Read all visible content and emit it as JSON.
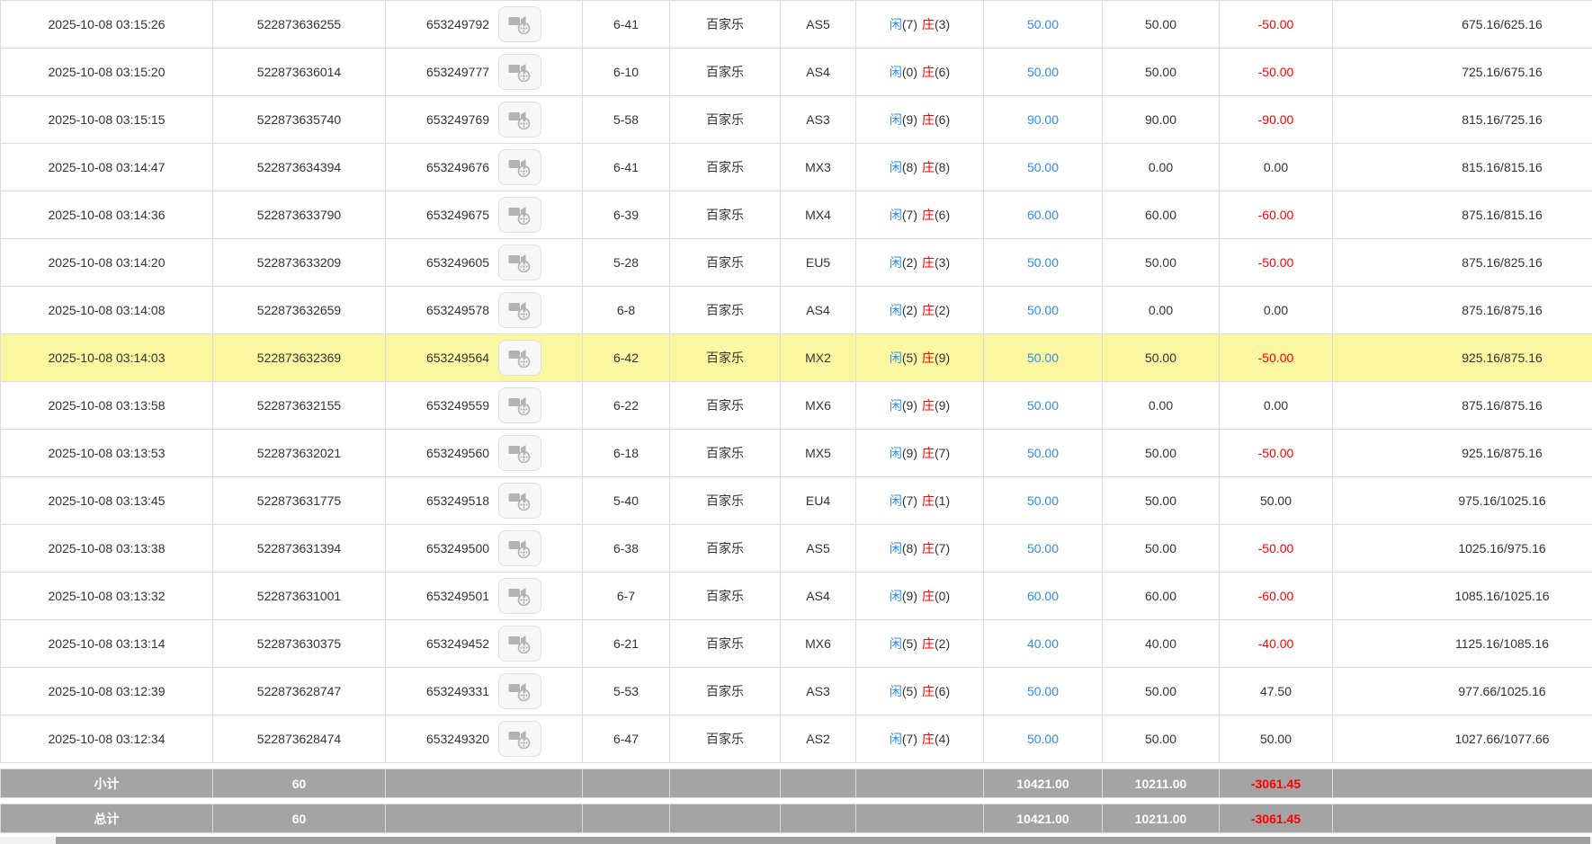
{
  "colors": {
    "accent_blue": "#2d8cf0",
    "accent_red": "#ff0000",
    "highlight_row": "#fbf7a1",
    "summary_bg": "#a4a4a4"
  },
  "result_labels": {
    "player": "闲",
    "banker": "庄"
  },
  "icons": {
    "round_video_icon": "video-replay-icon"
  },
  "rows": [
    {
      "time": "2025-10-08 03:15:26",
      "order_id": "522873636255",
      "round_id": "653249792",
      "shoe_round": "6-41",
      "game": "百家乐",
      "table": "AS5",
      "player_score": "(7)",
      "banker_score": "(3)",
      "bet": "50.00",
      "valid_bet": "50.00",
      "win_loss": "-50.00",
      "balance": "675.16/625.16",
      "highlighted": false
    },
    {
      "time": "2025-10-08 03:15:20",
      "order_id": "522873636014",
      "round_id": "653249777",
      "shoe_round": "6-10",
      "game": "百家乐",
      "table": "AS4",
      "player_score": "(0)",
      "banker_score": "(6)",
      "bet": "50.00",
      "valid_bet": "50.00",
      "win_loss": "-50.00",
      "balance": "725.16/675.16",
      "highlighted": false
    },
    {
      "time": "2025-10-08 03:15:15",
      "order_id": "522873635740",
      "round_id": "653249769",
      "shoe_round": "5-58",
      "game": "百家乐",
      "table": "AS3",
      "player_score": "(9)",
      "banker_score": "(6)",
      "bet": "90.00",
      "valid_bet": "90.00",
      "win_loss": "-90.00",
      "balance": "815.16/725.16",
      "highlighted": false
    },
    {
      "time": "2025-10-08 03:14:47",
      "order_id": "522873634394",
      "round_id": "653249676",
      "shoe_round": "6-41",
      "game": "百家乐",
      "table": "MX3",
      "player_score": "(8)",
      "banker_score": "(8)",
      "bet": "50.00",
      "valid_bet": "0.00",
      "win_loss": "0.00",
      "balance": "815.16/815.16",
      "highlighted": false
    },
    {
      "time": "2025-10-08 03:14:36",
      "order_id": "522873633790",
      "round_id": "653249675",
      "shoe_round": "6-39",
      "game": "百家乐",
      "table": "MX4",
      "player_score": "(7)",
      "banker_score": "(6)",
      "bet": "60.00",
      "valid_bet": "60.00",
      "win_loss": "-60.00",
      "balance": "875.16/815.16",
      "highlighted": false
    },
    {
      "time": "2025-10-08 03:14:20",
      "order_id": "522873633209",
      "round_id": "653249605",
      "shoe_round": "5-28",
      "game": "百家乐",
      "table": "EU5",
      "player_score": "(2)",
      "banker_score": "(3)",
      "bet": "50.00",
      "valid_bet": "50.00",
      "win_loss": "-50.00",
      "balance": "875.16/825.16",
      "highlighted": false
    },
    {
      "time": "2025-10-08 03:14:08",
      "order_id": "522873632659",
      "round_id": "653249578",
      "shoe_round": "6-8",
      "game": "百家乐",
      "table": "AS4",
      "player_score": "(2)",
      "banker_score": "(2)",
      "bet": "50.00",
      "valid_bet": "0.00",
      "win_loss": "0.00",
      "balance": "875.16/875.16",
      "highlighted": false
    },
    {
      "time": "2025-10-08 03:14:03",
      "order_id": "522873632369",
      "round_id": "653249564",
      "shoe_round": "6-42",
      "game": "百家乐",
      "table": "MX2",
      "player_score": "(5)",
      "banker_score": "(9)",
      "bet": "50.00",
      "valid_bet": "50.00",
      "win_loss": "-50.00",
      "balance": "925.16/875.16",
      "highlighted": true
    },
    {
      "time": "2025-10-08 03:13:58",
      "order_id": "522873632155",
      "round_id": "653249559",
      "shoe_round": "6-22",
      "game": "百家乐",
      "table": "MX6",
      "player_score": "(9)",
      "banker_score": "(9)",
      "bet": "50.00",
      "valid_bet": "0.00",
      "win_loss": "0.00",
      "balance": "875.16/875.16",
      "highlighted": false
    },
    {
      "time": "2025-10-08 03:13:53",
      "order_id": "522873632021",
      "round_id": "653249560",
      "shoe_round": "6-18",
      "game": "百家乐",
      "table": "MX5",
      "player_score": "(9)",
      "banker_score": "(7)",
      "bet": "50.00",
      "valid_bet": "50.00",
      "win_loss": "-50.00",
      "balance": "925.16/875.16",
      "highlighted": false
    },
    {
      "time": "2025-10-08 03:13:45",
      "order_id": "522873631775",
      "round_id": "653249518",
      "shoe_round": "5-40",
      "game": "百家乐",
      "table": "EU4",
      "player_score": "(7)",
      "banker_score": "(1)",
      "bet": "50.00",
      "valid_bet": "50.00",
      "win_loss": "50.00",
      "balance": "975.16/1025.16",
      "highlighted": false
    },
    {
      "time": "2025-10-08 03:13:38",
      "order_id": "522873631394",
      "round_id": "653249500",
      "shoe_round": "6-38",
      "game": "百家乐",
      "table": "AS5",
      "player_score": "(8)",
      "banker_score": "(7)",
      "bet": "50.00",
      "valid_bet": "50.00",
      "win_loss": "-50.00",
      "balance": "1025.16/975.16",
      "highlighted": false
    },
    {
      "time": "2025-10-08 03:13:32",
      "order_id": "522873631001",
      "round_id": "653249501",
      "shoe_round": "6-7",
      "game": "百家乐",
      "table": "AS4",
      "player_score": "(9)",
      "banker_score": "(0)",
      "bet": "60.00",
      "valid_bet": "60.00",
      "win_loss": "-60.00",
      "balance": "1085.16/1025.16",
      "highlighted": false
    },
    {
      "time": "2025-10-08 03:13:14",
      "order_id": "522873630375",
      "round_id": "653249452",
      "shoe_round": "6-21",
      "game": "百家乐",
      "table": "MX6",
      "player_score": "(5)",
      "banker_score": "(2)",
      "bet": "40.00",
      "valid_bet": "40.00",
      "win_loss": "-40.00",
      "balance": "1125.16/1085.16",
      "highlighted": false
    },
    {
      "time": "2025-10-08 03:12:39",
      "order_id": "522873628747",
      "round_id": "653249331",
      "shoe_round": "5-53",
      "game": "百家乐",
      "table": "AS3",
      "player_score": "(5)",
      "banker_score": "(6)",
      "bet": "50.00",
      "valid_bet": "50.00",
      "win_loss": "47.50",
      "balance": "977.66/1025.16",
      "highlighted": false
    },
    {
      "time": "2025-10-08 03:12:34",
      "order_id": "522873628474",
      "round_id": "653249320",
      "shoe_round": "6-47",
      "game": "百家乐",
      "table": "AS2",
      "player_score": "(7)",
      "banker_score": "(4)",
      "bet": "50.00",
      "valid_bet": "50.00",
      "win_loss": "50.00",
      "balance": "1027.66/1077.66",
      "highlighted": false
    }
  ],
  "summary": {
    "subtotal_label": "小计",
    "total_label": "总计",
    "count": "60",
    "bet_total": "10421.00",
    "valid_bet_total": "10211.00",
    "win_loss_total": "-3061.45"
  }
}
